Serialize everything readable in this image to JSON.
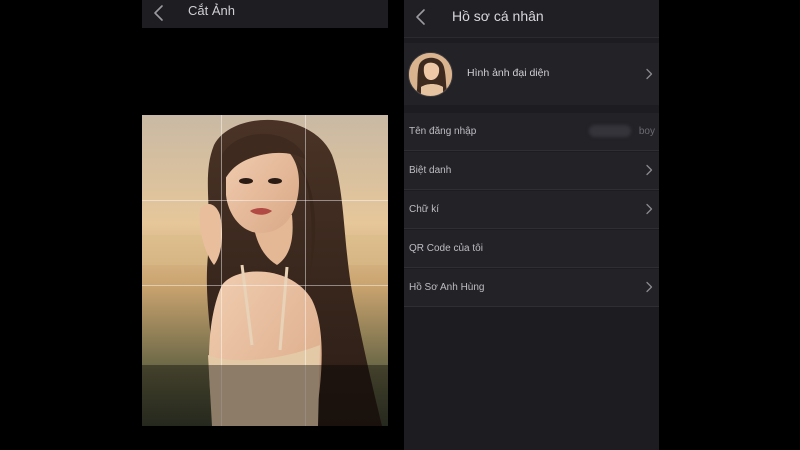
{
  "crop_screen": {
    "title": "Cắt Ảnh",
    "icons": {
      "back": "chevron-left-icon"
    }
  },
  "profile_screen": {
    "title": "Hồ sơ cá nhân",
    "icons": {
      "back": "chevron-left-icon",
      "row_chevron": "chevron-right-icon"
    },
    "avatar_label": "Hình ảnh đại diện",
    "rows": [
      {
        "label": "Tên đăng nhập",
        "value": "boy"
      },
      {
        "label": "Biệt danh"
      },
      {
        "label": "Chữ kí"
      },
      {
        "label": "QR Code của tôi"
      },
      {
        "label": "Hồ Sơ Anh Hùng"
      }
    ]
  },
  "colors": {
    "screen_bg": "#1c1c21",
    "row_bg": "#222227",
    "text_primary": "#cfcfd4",
    "text_muted": "#6b6b72"
  }
}
